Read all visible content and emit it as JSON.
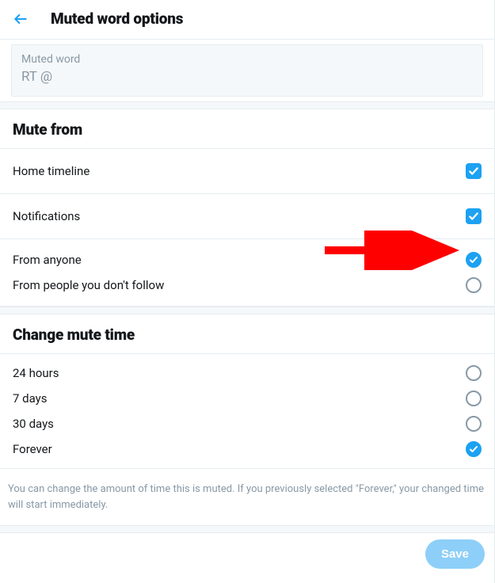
{
  "header": {
    "title": "Muted word options"
  },
  "input": {
    "label": "Muted word",
    "value": "RT @"
  },
  "sections": {
    "mute_from": {
      "title": "Mute from",
      "home_timeline": "Home timeline",
      "notifications": "Notifications",
      "from_anyone": "From anyone",
      "from_not_follow": "From people you don't follow"
    },
    "change_time": {
      "title": "Change mute time",
      "h24": "24 hours",
      "d7": "7 days",
      "d30": "30 days",
      "forever": "Forever"
    }
  },
  "info_text": "You can change the amount of time this is muted. If you previously selected \"Forever,\" your changed time will start immediately.",
  "footer": {
    "save": "Save"
  },
  "state": {
    "home_timeline_checked": true,
    "notifications_checked": true,
    "scope_selected": "from_anyone",
    "time_selected": "forever"
  },
  "colors": {
    "accent": "#1da1f2",
    "annotation": "#ff0000"
  }
}
